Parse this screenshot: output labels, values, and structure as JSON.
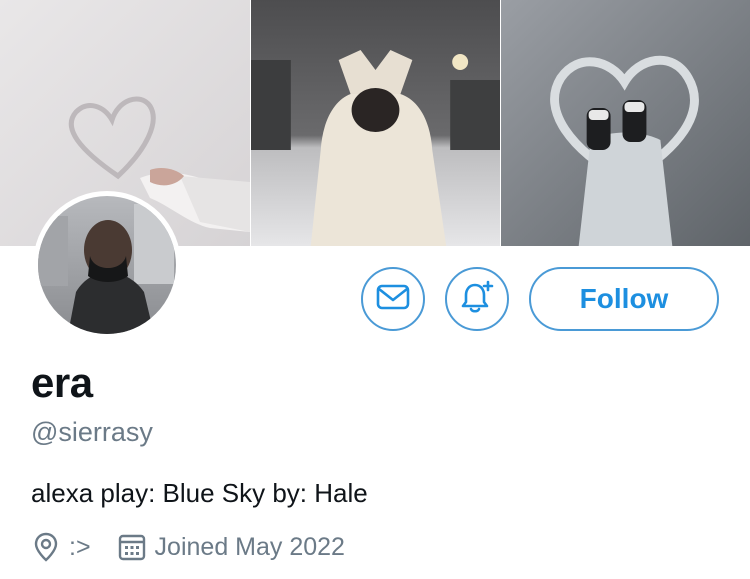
{
  "profile": {
    "display_name": "era",
    "handle": "@sierrasy",
    "bio": "alexa play: Blue Sky by: Hale",
    "location": ":>",
    "joined": "Joined May 2022"
  },
  "actions": {
    "follow_label": "Follow"
  },
  "icons": {
    "message": "envelope-icon",
    "notify": "bell-plus-icon",
    "location": "location-pin-icon",
    "calendar": "calendar-icon"
  },
  "colors": {
    "accent": "#1d8fe0",
    "border": "#4a9ad6",
    "secondary_text": "#6b7a87",
    "primary_text": "#0f1419"
  }
}
